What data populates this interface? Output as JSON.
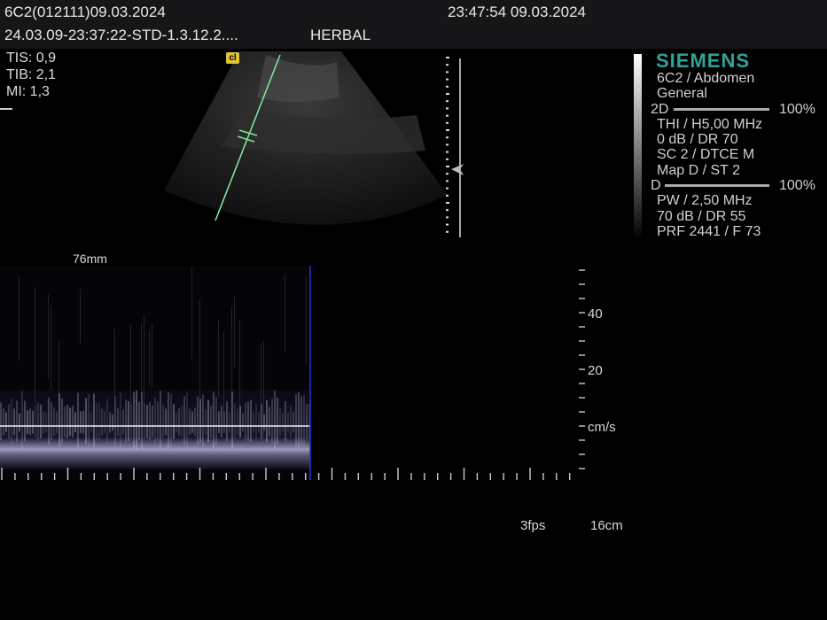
{
  "header": {
    "probe_date": "6C2(012111)09.03.2024",
    "time_date": "23:47:54 09.03.2024",
    "study_id": "24.03.09-23:37:22-STD-1.3.12.2....",
    "patient": "HERBAL"
  },
  "safety": {
    "tis": "TIS: 0,9",
    "tib": "TIB: 2,1",
    "mi": "MI:   1,3"
  },
  "badge": "cl",
  "brand": "SIEMENS",
  "settings": {
    "preset_1": "6C2 / Abdomen",
    "preset_2": "General",
    "mode_2d": "2D",
    "mode_2d_pct": "100%",
    "l1": "THI / H5,00 MHz",
    "l2": "0 dB / DR 70",
    "l3": "SC 2 / DTCE M",
    "l4": "Map D / ST 2",
    "mode_d": "D",
    "mode_d_pct": "100%",
    "l5": "PW / 2,50 MHz",
    "l6": "70 dB / DR 55",
    "l7": "PRF 2441 / F 73"
  },
  "doppler": {
    "sweep_label": "76mm",
    "scale_40": "40",
    "scale_20": "20",
    "unit": "cm/s"
  },
  "footer": {
    "fps": "3fps",
    "depth": "16cm"
  }
}
